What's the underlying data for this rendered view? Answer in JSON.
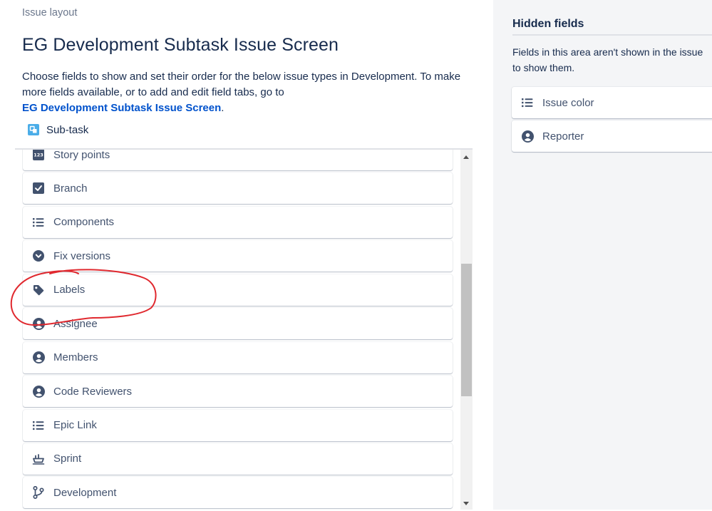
{
  "header": {
    "breadcrumb": "Issue layout",
    "title": "EG Development Subtask Issue Screen",
    "description": "Choose fields to show and set their order for the below issue types in Development. To make more fields available, or to add and edit field tabs, go to",
    "link_text": "EG Development Subtask Issue Screen",
    "link_suffix": "."
  },
  "issue_type": {
    "label": "Sub-task",
    "icon": "subtask-icon",
    "color": "#4bade8"
  },
  "fields": [
    {
      "label": "Story points",
      "icon": "number-icon"
    },
    {
      "label": "Branch",
      "icon": "checkbox-icon"
    },
    {
      "label": "Components",
      "icon": "list-icon"
    },
    {
      "label": "Fix versions",
      "icon": "dropdown-icon"
    },
    {
      "label": "Labels",
      "icon": "tag-icon"
    },
    {
      "label": "Assignee",
      "icon": "user-icon"
    },
    {
      "label": "Members",
      "icon": "user-icon"
    },
    {
      "label": "Code Reviewers",
      "icon": "user-icon"
    },
    {
      "label": "Epic Link",
      "icon": "list-icon"
    },
    {
      "label": "Sprint",
      "icon": "sprint-icon"
    },
    {
      "label": "Development",
      "icon": "branch-icon"
    }
  ],
  "hidden_fields": {
    "title": "Hidden fields",
    "description_line1": "Fields in this area aren't shown in the issue",
    "description_line2": "to show them.",
    "items": [
      {
        "label": "Issue color",
        "icon": "list-icon"
      },
      {
        "label": "Reporter",
        "icon": "user-icon"
      }
    ]
  },
  "colors": {
    "icon": "#42526e",
    "link": "#0052cc",
    "annotation": "#e0282e",
    "panel_bg": "#f4f5f7"
  }
}
